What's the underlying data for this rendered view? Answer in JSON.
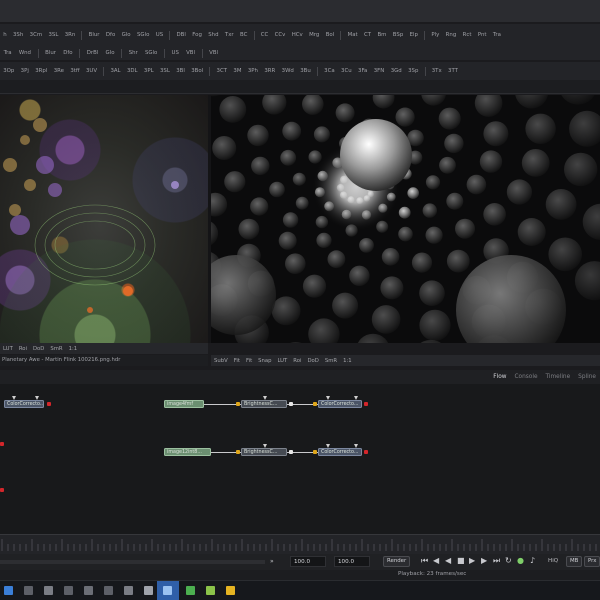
{
  "toolbar1": [
    "h",
    "3Sh",
    "3Cm",
    "3SL",
    "3Rn",
    "Blur",
    "Dfo",
    "Glo",
    "SGlo",
    "US",
    "DBl",
    "Fog",
    "Shd",
    "Txr",
    "BC",
    "CC",
    "CCv",
    "HCv",
    "Mrg",
    "Bol",
    "Mat",
    "CT",
    "Bm",
    "BSp",
    "Elp",
    "Ply",
    "Rng",
    "Rct",
    "Pnt",
    "Tra"
  ],
  "toolbar2": [
    "Tra",
    "Wnd",
    "Blur",
    "Dfo",
    "DrBl",
    "Glo",
    "Shr",
    "SGlo",
    "US",
    "VBl",
    "VBl"
  ],
  "toolbar3": [
    "3Op",
    "3Pj",
    "3Rpl",
    "3Re",
    "3tff",
    "3UV",
    "3AL",
    "3DL",
    "3PL",
    "3SL",
    "3Bl",
    "3Bol",
    "3CT",
    "3M",
    "3Ph",
    "3RR",
    "3Wd",
    "3Bu",
    "3Ca",
    "3Cu",
    "3Fa",
    "3FN",
    "3Gd",
    "3Sp",
    "3Tx",
    "3TT"
  ],
  "viewer_left_bar": [
    "LUT",
    "Roi",
    "DoD",
    "SmR",
    "1:1"
  ],
  "viewer_left_caption": "Planetary Awe - Martin Flink 100216.png.hdr",
  "viewer_right_bar": [
    "SubV",
    "Fit",
    "Fit",
    "Snap",
    "LUT",
    "Roi",
    "DoD",
    "SmR",
    "1:1"
  ],
  "flow_tabs": [
    "Flow",
    "Console",
    "Timeline",
    "Spline"
  ],
  "flow_active_tab": "Flow",
  "nodes": {
    "colorcorrector_left": "ColorCorrecto...",
    "loader_1": "image4fmf",
    "brightness_1": "BrightnessC...",
    "colorcorrector_1": "ColorCorrecto...",
    "loader_2": "image12int8...",
    "brightness_2": "BrightnessC...",
    "colorcorrector_2": "ColorCorrecto..."
  },
  "playback": {
    "field1": "100.0",
    "field2": "100.0",
    "render_label": "Render",
    "hiq_label": "HiQ",
    "mb_label": "MB",
    "prx_label": "Prx",
    "status": "Playback: 23 frames/sec"
  },
  "colors": {
    "accent_blue": "#1565d8",
    "node_red": "#d3262b",
    "node_yellow": "#e0a71b"
  }
}
